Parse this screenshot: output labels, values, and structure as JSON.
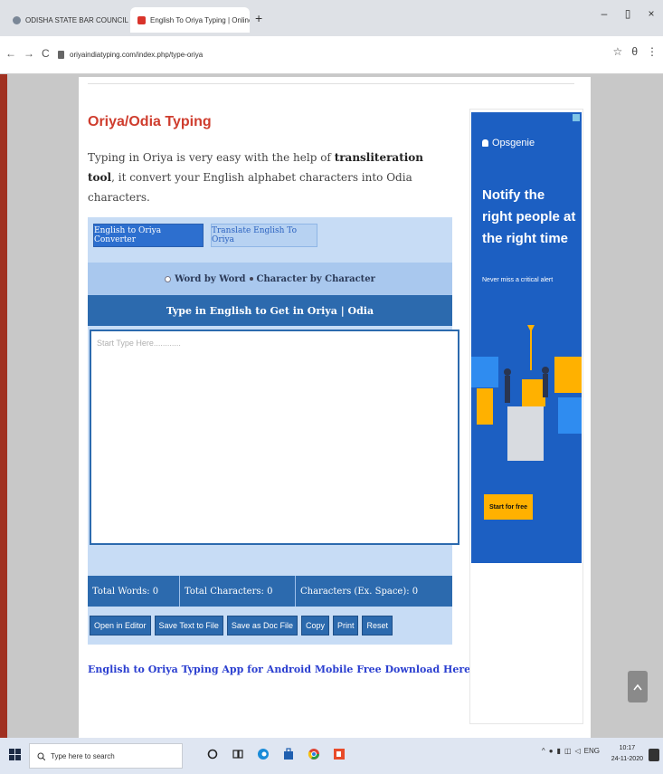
{
  "browser": {
    "tabs": [
      {
        "title": "ODISHA STATE BAR COUNCIL",
        "close": "×"
      },
      {
        "title": "English To Oriya Typing | Online",
        "close": "×"
      }
    ],
    "new_tab": "+",
    "window_controls": {
      "minimize": "–",
      "maximize": "▯",
      "close": "×"
    },
    "nav": {
      "back": "←",
      "forward": "→",
      "reload": "C"
    },
    "url": "oriyaindiatyping.com/index.php/type-oriya",
    "omni_right": {
      "star": "☆",
      "profile": "θ",
      "menu": "⋮"
    }
  },
  "page": {
    "heading": "Oriya/Odia Typing",
    "intro_before": "Typing in Oriya is very easy with the help of ",
    "intro_bold": "transliteration tool",
    "intro_after": ", it convert your English alphabet characters into Odia characters.",
    "tabs": {
      "converter": "English to Oriya Converter",
      "translate": "Translate English To Oriya"
    },
    "mode": {
      "word": "Word by Word",
      "character": "Character by Character"
    },
    "type_bar": "Type in English to Get in Oriya | Odia",
    "editor_placeholder": "Start Type Here............",
    "stats": {
      "words": "Total Words: 0",
      "characters": "Total Characters: 0",
      "no_space": "Characters (Ex. Space): 0"
    },
    "buttons": {
      "open_editor": "Open in Editor",
      "save_text": "Save Text to File",
      "save_doc": "Save as Doc File",
      "copy": "Copy",
      "print": "Print",
      "reset": "Reset"
    },
    "app_link": "English to Oriya Typing App for Android Mobile Free Download Here"
  },
  "ad": {
    "brand": "Opsgenie",
    "headline": "Notify the right people at the right time",
    "sub": "Never miss a critical alert",
    "cta": "Start for free"
  },
  "taskbar": {
    "search_placeholder": "Type here to search",
    "tray_lang": "ENG",
    "time": "10:17",
    "date": "24-11-2020"
  },
  "colors": {
    "heading": "#cf3d2e",
    "primary_blue": "#2c6aae",
    "toolbox_bg": "#c7dcf5",
    "link": "#2b3fd0",
    "ad_bg": "#1c5fc2",
    "ad_cta": "#ffb100"
  }
}
